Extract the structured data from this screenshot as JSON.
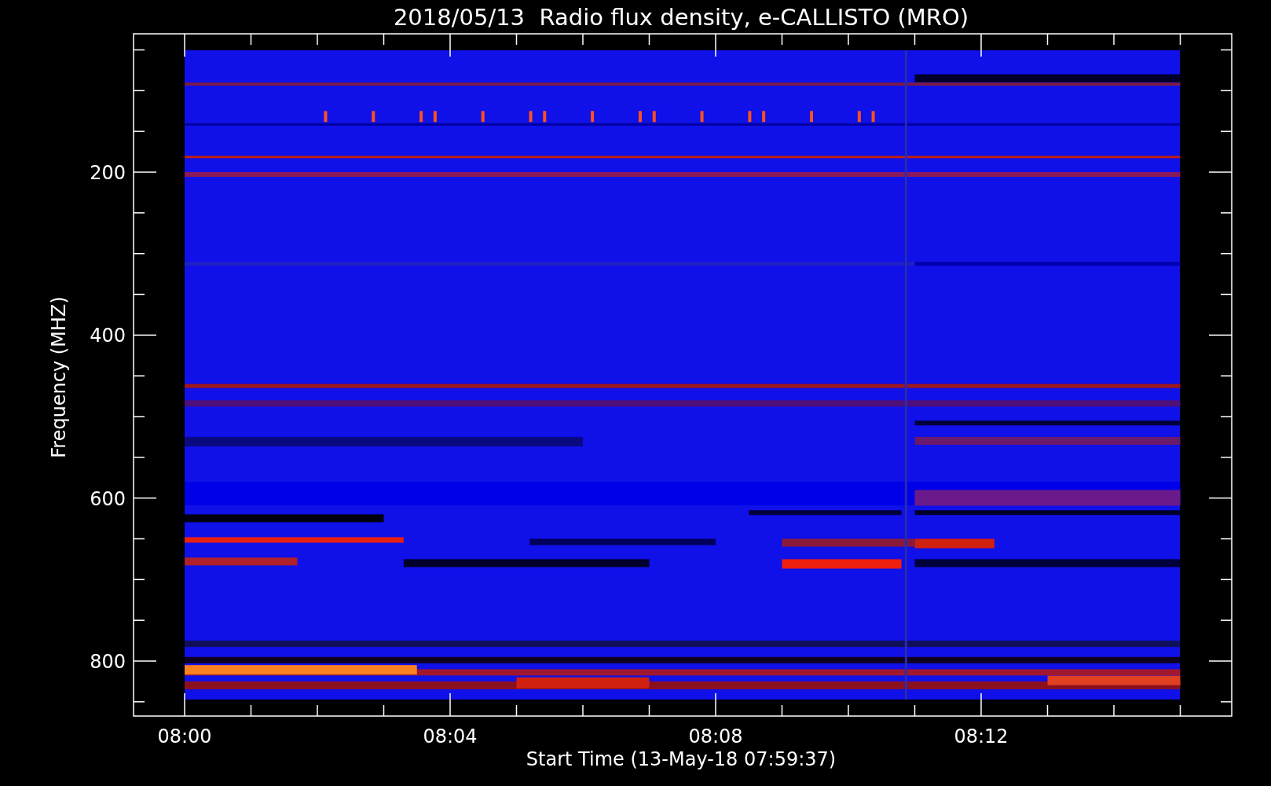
{
  "title": "2018/05/13  Radio flux density, e-CALLISTO (MRO)",
  "y_axis": {
    "label": "Frequency (MHZ)",
    "ticks": [
      "200",
      "400",
      "600",
      "800"
    ]
  },
  "x_axis": {
    "label": "Start Time (13-May-18 07:59:37)",
    "ticks": [
      "08:00",
      "08:04",
      "08:08",
      "08:12"
    ]
  }
}
